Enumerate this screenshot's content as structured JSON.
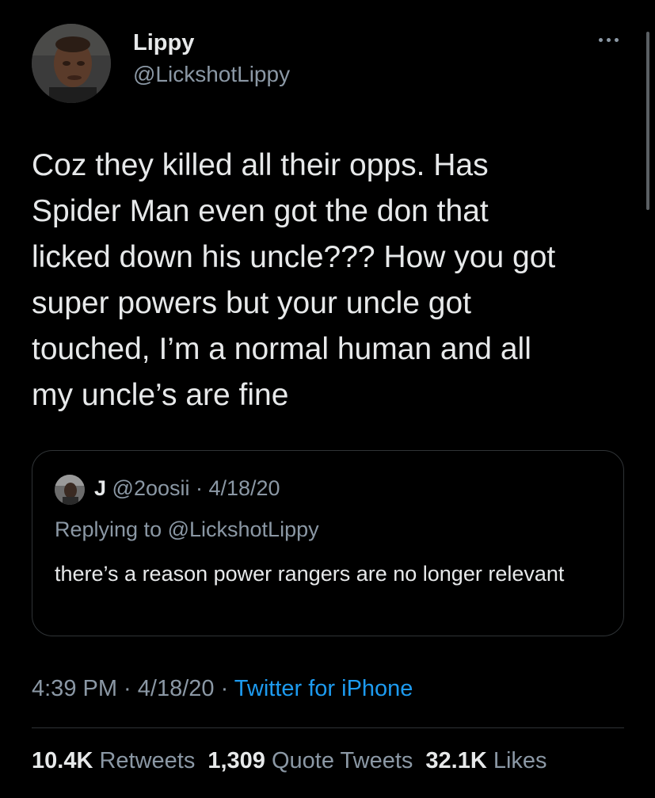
{
  "author": {
    "name": "Lippy",
    "handle": "@LickshotLippy"
  },
  "tweet": {
    "text": "Coz they killed all their opps. Has\nSpider Man even got the don that\nlicked down his uncle??? How you got\nsuper powers but your uncle got\ntouched, I’m a normal human and all\nmy uncle’s are fine"
  },
  "quoted": {
    "name": "J",
    "meta": " @2oosii · 4/18/20",
    "replying_prefix": "Replying to ",
    "replying_to": "@LickshotLippy",
    "text": "there’s a reason power rangers are no longer relevant"
  },
  "meta": {
    "time_date": "4:39 PM · 4/18/20 · ",
    "source": "Twitter for iPhone"
  },
  "stats": {
    "retweets_count": "10.4K",
    "retweets_label": "Retweets",
    "quotes_count": "1,309",
    "quotes_label": "Quote Tweets",
    "likes_count": "32.1K",
    "likes_label": "Likes"
  },
  "colors": {
    "background": "#000000",
    "text": "#e7e9ea",
    "secondary": "#8b98a5",
    "link": "#1d9bf0",
    "border": "#2f3336"
  },
  "icons": {
    "more": "more-horizontal-icon"
  }
}
